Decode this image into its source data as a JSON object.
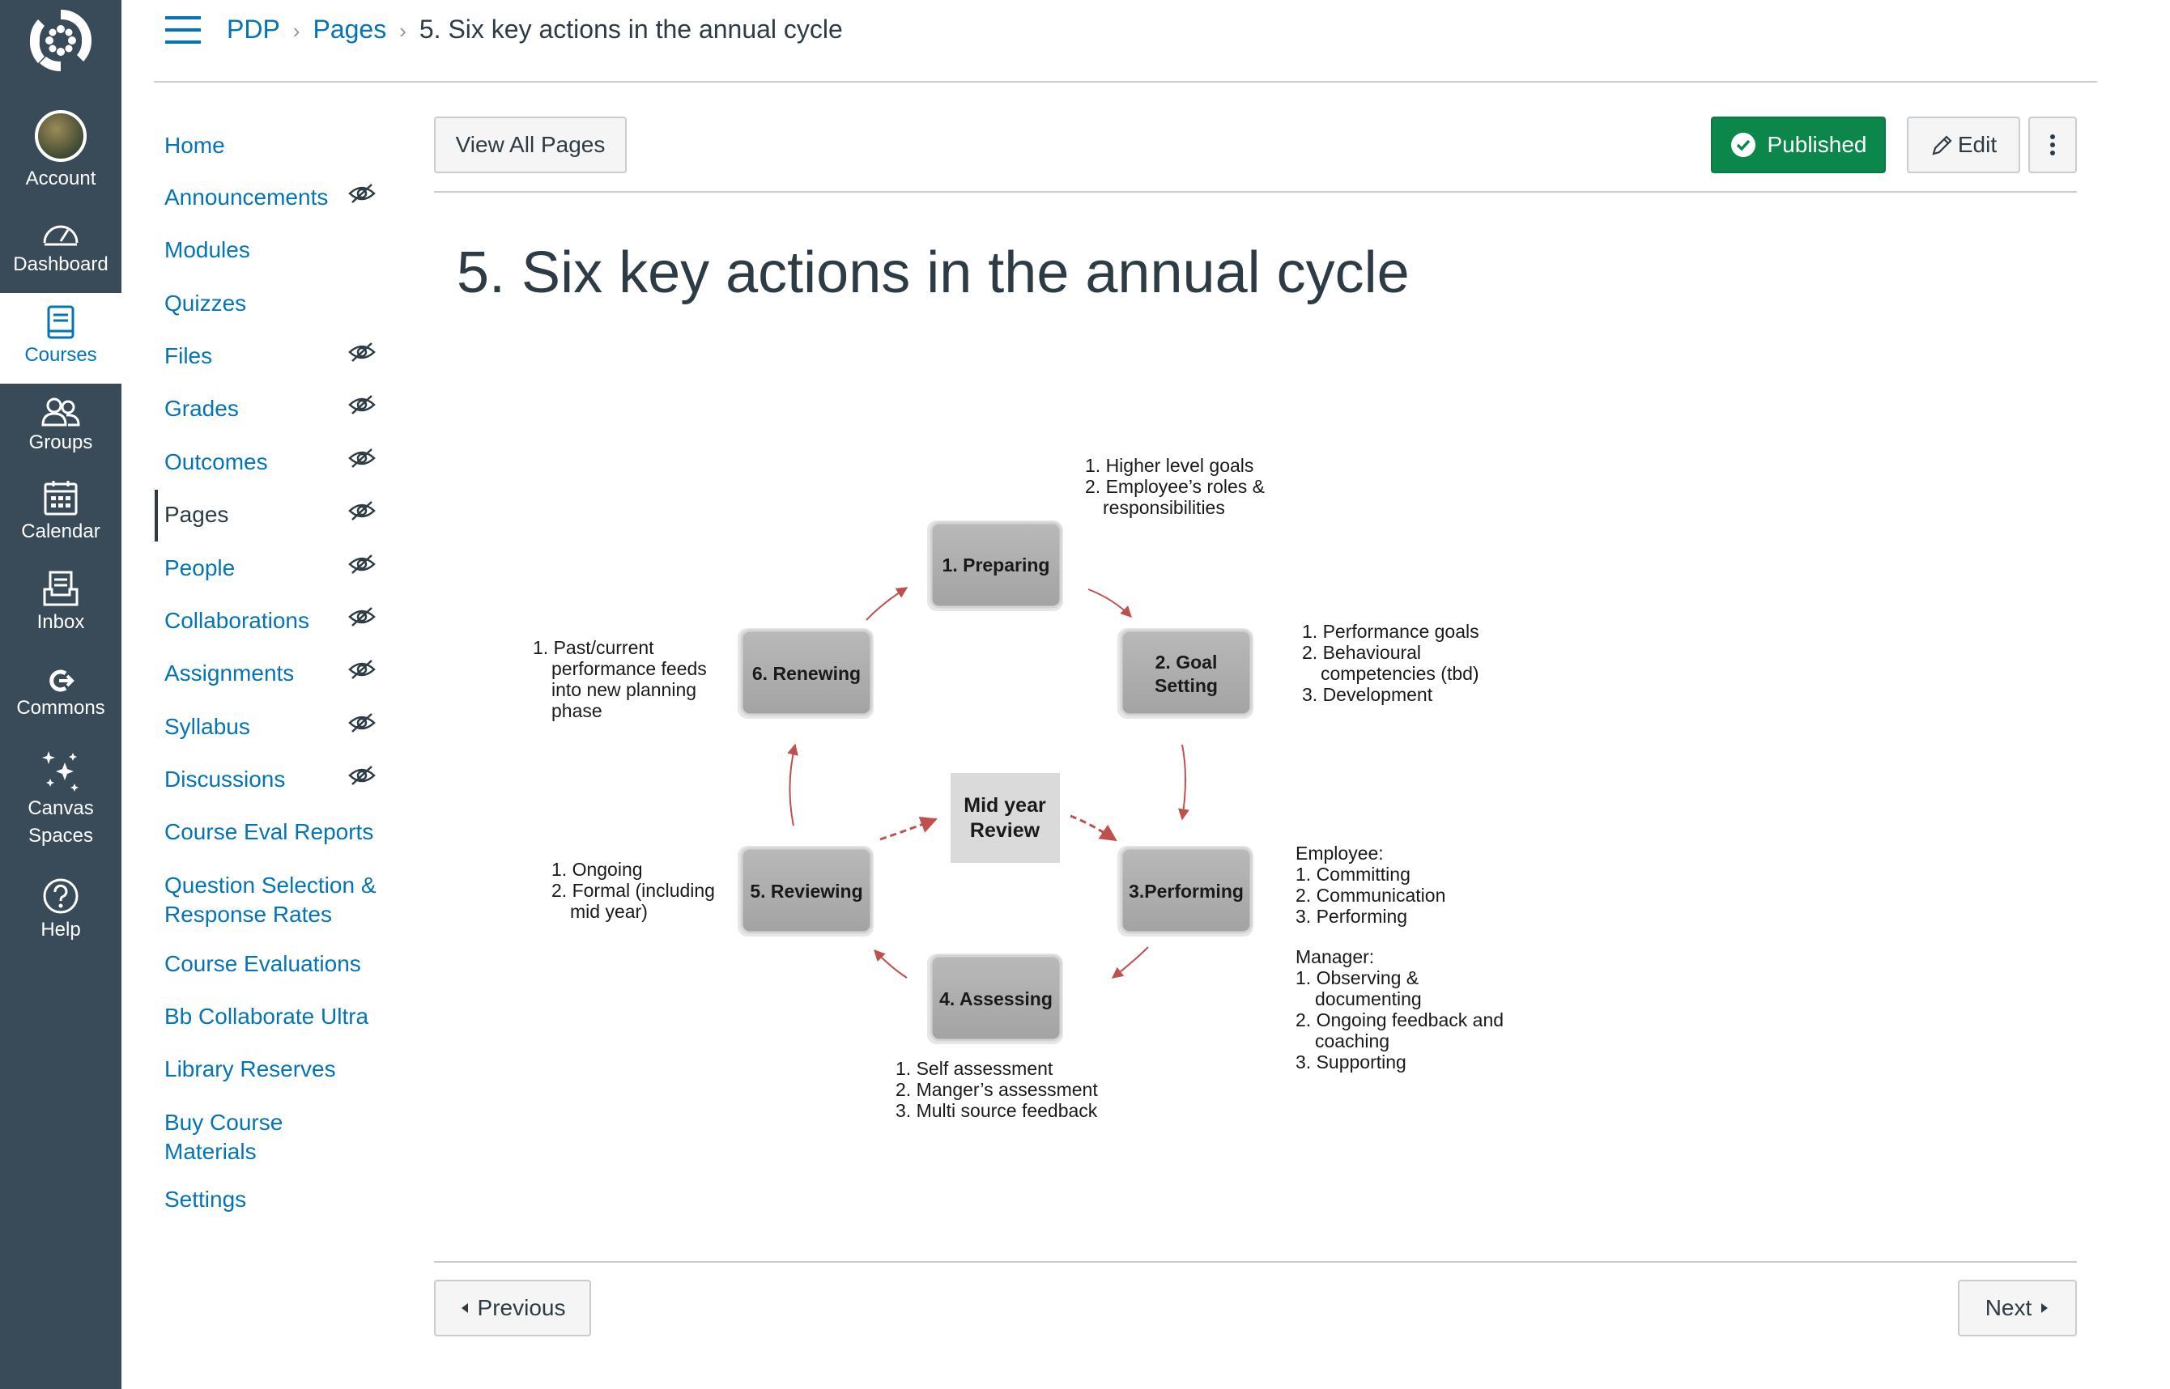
{
  "global_nav": {
    "account": "Account",
    "dashboard": "Dashboard",
    "courses": "Courses",
    "groups": "Groups",
    "calendar": "Calendar",
    "inbox": "Inbox",
    "commons": "Commons",
    "canvas_spaces_1": "Canvas",
    "canvas_spaces_2": "Spaces",
    "help": "Help"
  },
  "breadcrumbs": {
    "course": "PDP",
    "section": "Pages",
    "current": "5. Six key actions in the annual cycle"
  },
  "course_nav": {
    "items": [
      {
        "label": "Home",
        "hidden": false
      },
      {
        "label": "Announcements",
        "hidden": true
      },
      {
        "label": "Modules",
        "hidden": false
      },
      {
        "label": "Quizzes",
        "hidden": false
      },
      {
        "label": "Files",
        "hidden": true
      },
      {
        "label": "Grades",
        "hidden": true
      },
      {
        "label": "Outcomes",
        "hidden": true
      },
      {
        "label": "Pages",
        "hidden": true,
        "active": true
      },
      {
        "label": "People",
        "hidden": true
      },
      {
        "label": "Collaborations",
        "hidden": true
      },
      {
        "label": "Assignments",
        "hidden": true
      },
      {
        "label": "Syllabus",
        "hidden": true
      },
      {
        "label": "Discussions",
        "hidden": true
      },
      {
        "label": "Course Eval Reports",
        "hidden": false
      },
      {
        "label": "Question Selection &",
        "label2": "Response Rates",
        "hidden": false
      },
      {
        "label": "Course Evaluations",
        "hidden": false
      },
      {
        "label": "Bb Collaborate Ultra",
        "hidden": false
      },
      {
        "label": "Library Reserves",
        "hidden": false
      },
      {
        "label": "Buy Course",
        "label2": "Materials",
        "hidden": false
      },
      {
        "label": "Settings",
        "hidden": false
      }
    ]
  },
  "toolbar": {
    "view_all": "View All Pages",
    "published": "Published",
    "edit": "Edit"
  },
  "page": {
    "title": "5. Six key actions in the annual cycle"
  },
  "diagram": {
    "boxes": {
      "preparing": "1. Preparing",
      "goal_1": "2. Goal",
      "goal_2": "Setting",
      "performing": "3.Performing",
      "assessing": "4. Assessing",
      "reviewing": "5. Reviewing",
      "renewing": "6. Renewing",
      "midyear_1": "Mid year",
      "midyear_2": "Review"
    },
    "notes": {
      "preparing": [
        "1. Higher level goals",
        "2. Employee’s roles &",
        "responsibilities"
      ],
      "goal": [
        "1. Performance goals",
        "2. Behavioural",
        "competencies (tbd)",
        "3. Development"
      ],
      "employee": [
        "Employee:",
        "1. Committing",
        "2. Communication",
        "3. Performing"
      ],
      "manager": [
        "Manager:",
        "1. Observing &",
        "documenting",
        "2. Ongoing feedback and",
        "coaching",
        "3. Supporting"
      ],
      "assessing": [
        "1. Self assessment",
        "2. Manger’s assessment",
        "3. Multi source feedback"
      ],
      "reviewing": [
        "1. Ongoing",
        "2. Formal (including",
        "mid year)"
      ],
      "renewing": [
        "1. Past/current",
        "performance feeds",
        "into new planning",
        "phase"
      ]
    }
  },
  "footer": {
    "previous": "Previous",
    "next": "Next"
  },
  "colors": {
    "nav_bg": "#394b58",
    "link": "#0374b5",
    "published": "#0b874b",
    "arrow": "#c0504d"
  }
}
